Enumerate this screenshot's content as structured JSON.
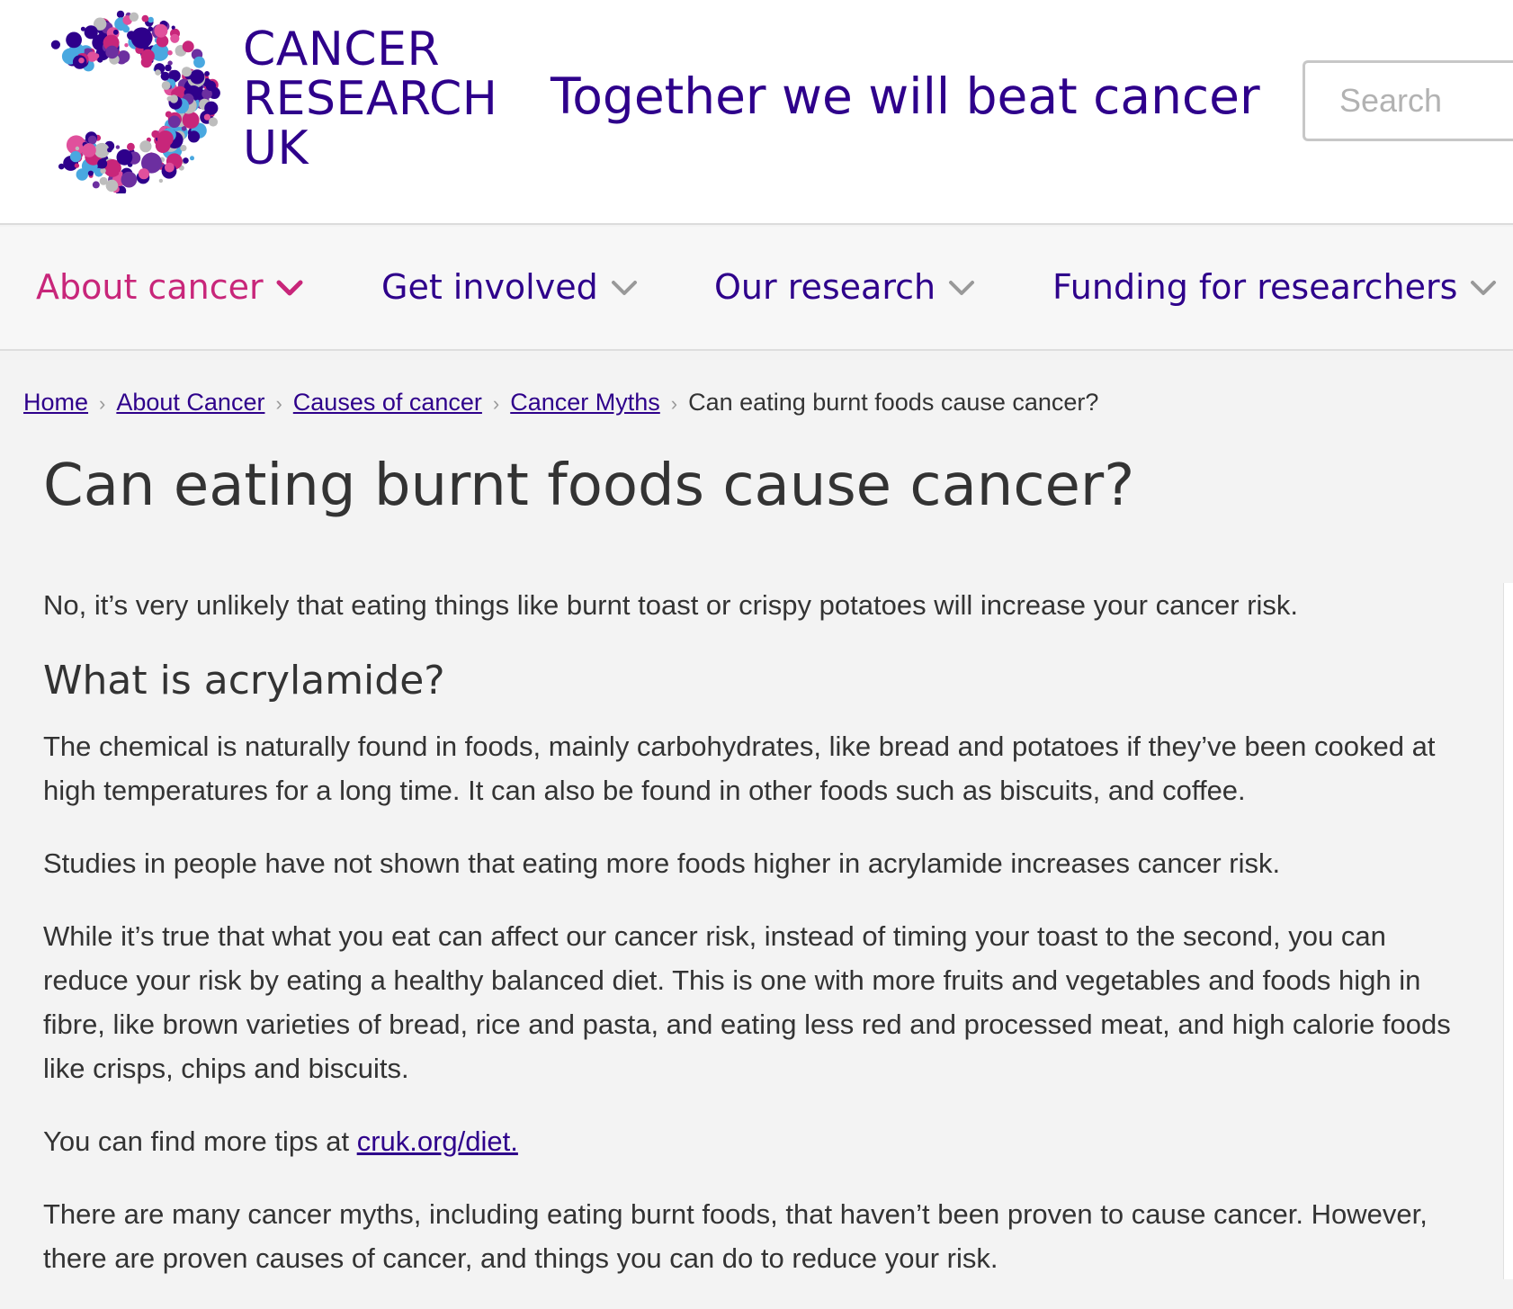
{
  "header": {
    "logo_lines": [
      "CANCER",
      "RESEARCH",
      "UK"
    ],
    "tagline": "Together we will beat cancer",
    "search_placeholder": "Search"
  },
  "nav": {
    "items": [
      {
        "label": "About cancer",
        "active": true
      },
      {
        "label": "Get involved",
        "active": false
      },
      {
        "label": "Our research",
        "active": false
      },
      {
        "label": "Funding for researchers",
        "active": false
      }
    ]
  },
  "breadcrumb": {
    "links": [
      "Home",
      "About Cancer",
      "Causes of cancer",
      "Cancer Myths"
    ],
    "current": "Can eating burnt foods cause cancer?"
  },
  "article": {
    "title": "Can eating burnt foods cause cancer?",
    "intro": "No, it’s very unlikely that eating things like burnt toast or crispy potatoes will increase your cancer risk.",
    "heading": "What is acrylamide?",
    "p1": "The chemical is naturally found in foods, mainly carbohydrates, like bread and potatoes if they’ve been cooked at high temperatures for a long time. It can also be found in other foods such as biscuits, and coffee.",
    "p2": "Studies in people have not shown that eating more foods higher in acrylamide increases cancer risk.",
    "p3": "While it’s true that what you eat can affect our cancer risk, instead of timing your toast to the second, you can reduce your risk by eating a healthy balanced diet. This is one with more fruits and vegetables and foods high in fibre, like brown varieties of bread, rice and pasta, and eating less red and processed meat, and high calorie foods like crisps, chips and biscuits.",
    "p4_prefix": "You can find more tips at ",
    "p4_link": "cruk.org/diet.",
    "p5": "There are many cancer myths, including eating burnt foods, that haven’t been proven to cause cancer. However, there are proven causes of cancer, and things you can do to reduce your risk."
  },
  "colors": {
    "brand_purple": "#2e008b",
    "brand_pink": "#c8267a",
    "text": "#333333",
    "page_bg": "#f3f3f3"
  },
  "icons": {
    "logo": "cancer-research-uk-dotted-c-logo",
    "nav_chevron": "chevron-down-icon",
    "breadcrumb_separator": "chevron-right-icon"
  }
}
